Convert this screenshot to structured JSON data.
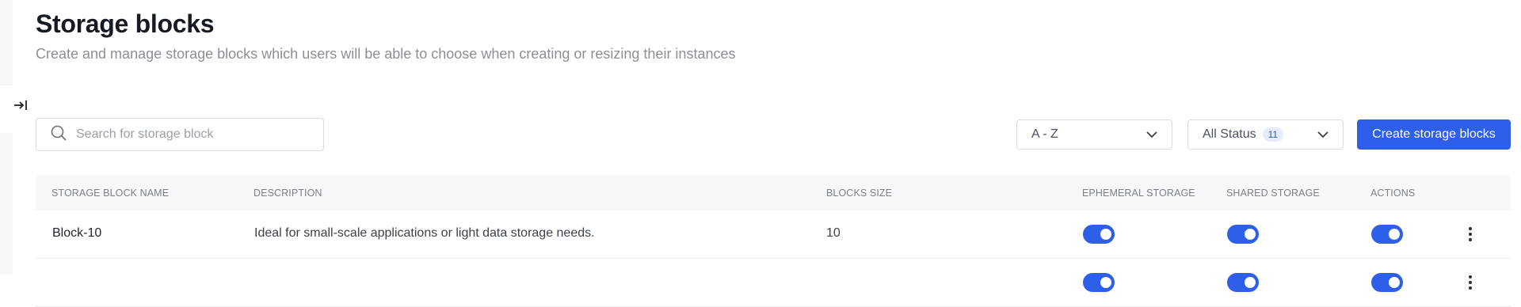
{
  "header": {
    "title": "Storage blocks",
    "subtitle": "Create and manage storage blocks which users will be able to choose when creating or resizing their instances"
  },
  "toolbar": {
    "search_placeholder": "Search for storage block",
    "search_value": "",
    "sort_value": "A - Z",
    "status_value": "All Status",
    "status_count": "11",
    "create_label": "Create storage blocks"
  },
  "table": {
    "columns": {
      "name": "STORAGE BLOCK NAME",
      "description": "DESCRIPTION",
      "size": "BLOCKS SIZE",
      "ephemeral": "EPHEMERAL STORAGE",
      "shared": "SHARED STORAGE",
      "actions": "ACTIONS"
    },
    "rows": [
      {
        "name": "Block-10",
        "description": "Ideal for small-scale applications or light data storage needs.",
        "size": "10",
        "ephemeral": true,
        "shared": true,
        "action_toggle": true
      },
      {
        "name": "",
        "description": "",
        "size": "",
        "ephemeral": true,
        "shared": true,
        "action_toggle": true
      }
    ]
  },
  "colors": {
    "accent": "#2d5fe8",
    "badge_bg": "#e6ecfb",
    "header_bg": "#f7f8f9"
  },
  "icons": [
    "collapse-sidebar-icon",
    "search-icon",
    "chevron-down-icon",
    "kebab-menu-icon"
  ]
}
